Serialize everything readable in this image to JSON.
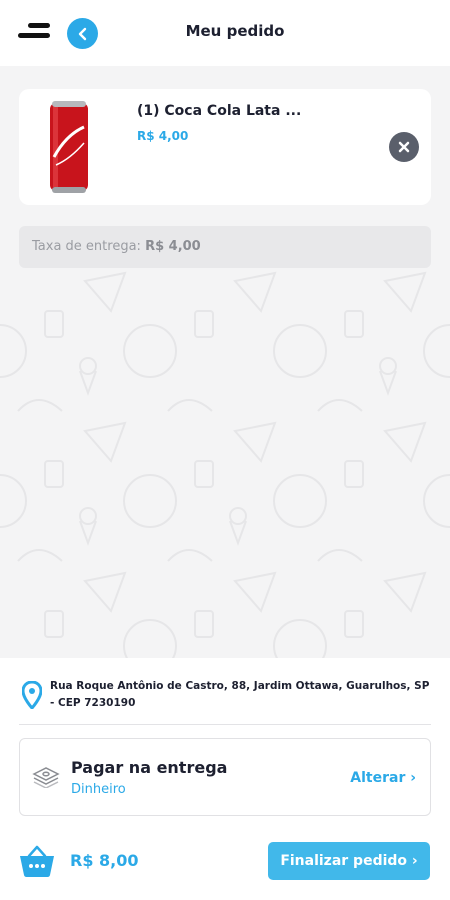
{
  "header": {
    "title": "Meu pedido",
    "menu_icon": "hamburger-icon",
    "back_icon": "chevron-left-icon"
  },
  "cart": {
    "items": [
      {
        "name": "(1) Coca Cola Lata ...",
        "price": "R$ 4,00",
        "image": "coca-cola-can"
      }
    ],
    "delivery_fee_label": "Taxa de entrega:",
    "delivery_fee_value": "R$ 4,00"
  },
  "address": {
    "text": "Rua Roque Antônio de Castro, 88, Jardim Ottawa, Guarulhos, SP - CEP 7230190"
  },
  "payment": {
    "title": "Pagar na entrega",
    "method": "Dinheiro",
    "change_label": "Alterar ›"
  },
  "footer": {
    "total": "R$ 8,00",
    "finalize_label": "Finalizar pedido ›"
  },
  "colors": {
    "accent": "#2ba9e7",
    "button": "#41b8ea",
    "background": "#f4f4f5",
    "remove": "#5a5f6b"
  }
}
